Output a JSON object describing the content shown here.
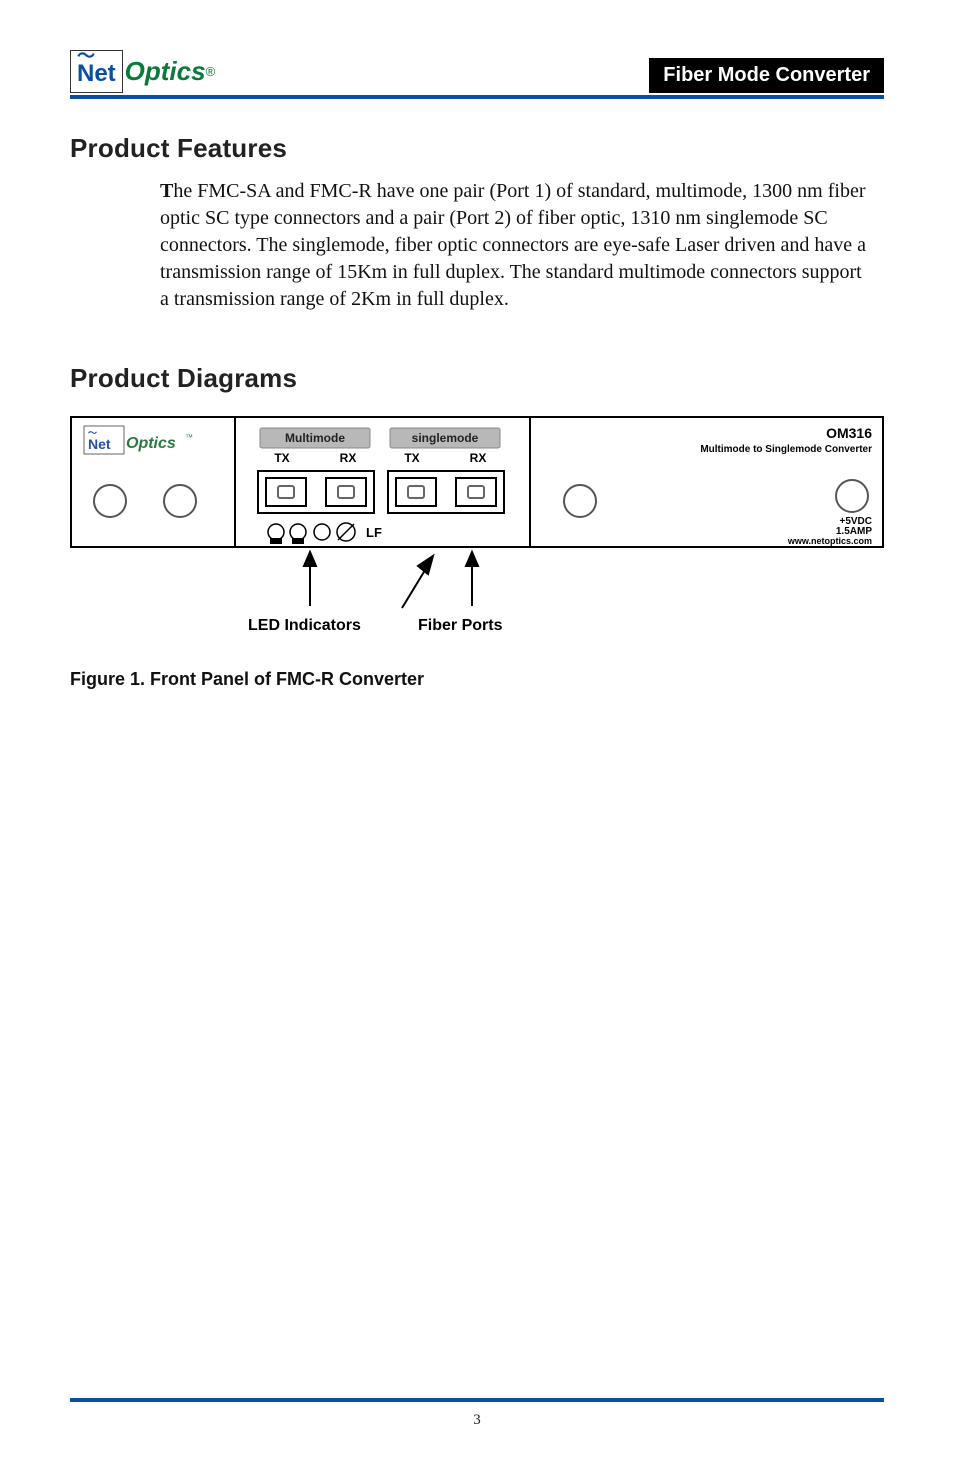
{
  "header": {
    "logo": {
      "net": "Net",
      "optics": "Optics",
      "reg": "®"
    },
    "badge": "Fiber Mode Converter"
  },
  "sections": {
    "features_heading": "Product Features",
    "features_body": "he FMC-SA and FMC-R have one pair (Port 1) of standard, multimode, 1300 nm fiber optic SC type connectors and a pair (Port 2) of fiber optic, 1310 nm singlemode SC connectors.  The singlemode, fiber optic connectors are eye-safe Laser driven and have a transmission range of 15Km in full duplex.  The standard multimode connectors support a transmission range of 2Km in full duplex.",
    "features_dropcap": "T",
    "diagrams_heading": "Product Diagrams"
  },
  "diagram": {
    "brand_net": "Net",
    "brand_optics": "Optics",
    "multimode_label": "Multimode",
    "singlemode_label": "singlemode",
    "tx": "TX",
    "rx": "RX",
    "lf": "LF",
    "model": "OM316",
    "model_sub": "Multimode to Singlemode Converter",
    "pwr_line1": "+5VDC",
    "pwr_line2": "1.5AMP",
    "url": "www.netoptics.com",
    "call_led": "LED Indicators",
    "call_fiber": "Fiber Ports"
  },
  "figure": {
    "strong": "Figure 1. ",
    "rest": "Front Panel of FMC-R Converter"
  },
  "page_number": "3"
}
